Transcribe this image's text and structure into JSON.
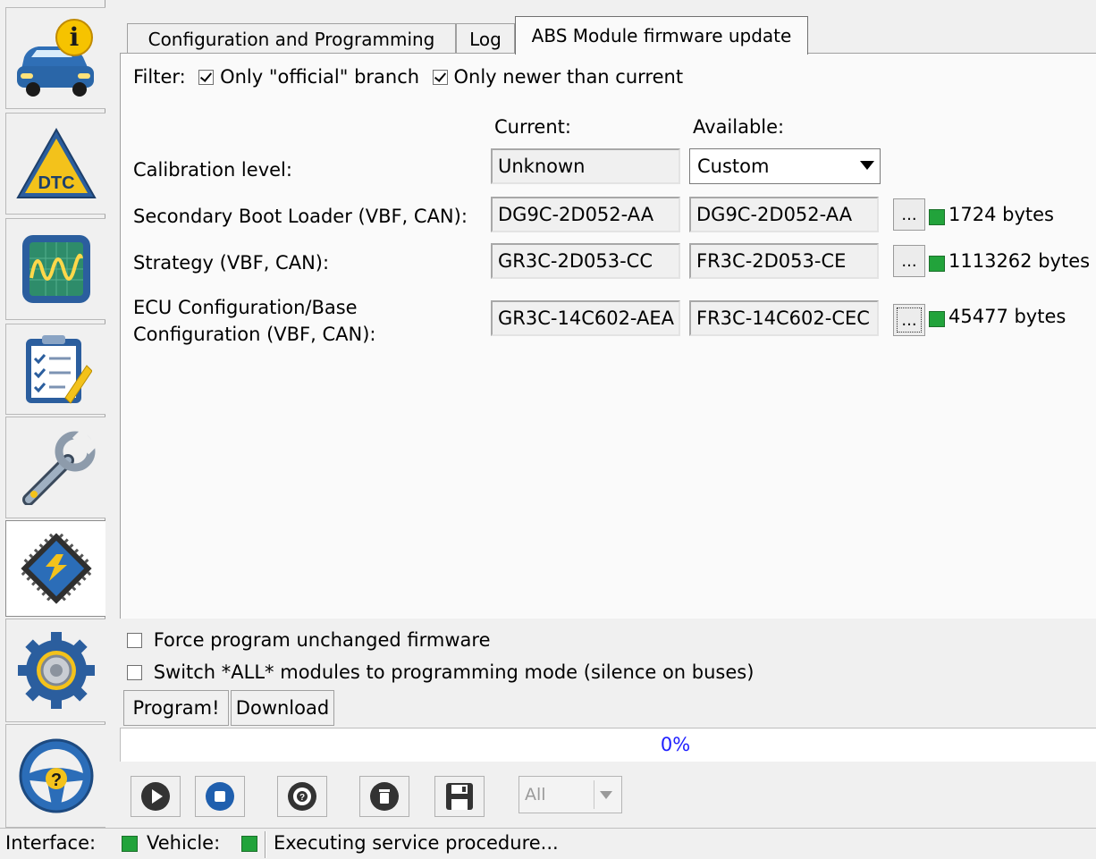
{
  "sidebar": {
    "items": [
      {
        "icon": "vehicle-info-icon"
      },
      {
        "icon": "dtc-warning-icon",
        "label": "DTC"
      },
      {
        "icon": "oscilloscope-icon"
      },
      {
        "icon": "checklist-icon"
      },
      {
        "icon": "wrench-icon"
      },
      {
        "icon": "module-programming-icon",
        "active": true
      },
      {
        "icon": "settings-gear-icon"
      },
      {
        "icon": "help-steering-wheel-icon",
        "label": "?"
      }
    ]
  },
  "tabs": [
    {
      "label": "Configuration and Programming",
      "active": false
    },
    {
      "label": "Log",
      "active": false
    },
    {
      "label": "ABS Module firmware update",
      "active": true
    }
  ],
  "filter": {
    "label": "Filter:",
    "official_label": "Only \"official\" branch",
    "official_checked": true,
    "newer_label": "Only newer than current",
    "newer_checked": true
  },
  "columns": {
    "current": "Current:",
    "available": "Available:"
  },
  "calibration": {
    "label": "Calibration level:",
    "current": "Unknown",
    "available": "Custom"
  },
  "rows": [
    {
      "label": "Secondary Boot Loader (VBF, CAN):",
      "current": "DG9C-2D052-AA",
      "available": "DG9C-2D052-AA",
      "browse": "...",
      "size": "1724 bytes"
    },
    {
      "label": "Strategy (VBF, CAN):",
      "current": "GR3C-2D053-CC",
      "available": "FR3C-2D053-CE",
      "browse": "...",
      "size": "1113262 bytes"
    },
    {
      "label_line1": "ECU Configuration/Base",
      "label_line2": "Configuration (VBF, CAN):",
      "current": "GR3C-14C602-AEA",
      "available": "FR3C-14C602-CEC",
      "browse": "...",
      "size": "45477 bytes"
    }
  ],
  "options": {
    "force_label": "Force program unchanged firmware",
    "force_checked": false,
    "switch_label": "Switch *ALL* modules to programming mode (silence on buses)",
    "switch_checked": false
  },
  "buttons": {
    "program": "Program!",
    "download": "Download"
  },
  "progress": {
    "value": 0,
    "text": "0%"
  },
  "toolbar": {
    "icons": [
      "play-icon",
      "stop-icon",
      "lifebuoy-icon",
      "trash-icon",
      "save-icon"
    ],
    "filter_value": "All"
  },
  "status": {
    "interface_label": "Interface:",
    "vehicle_label": "Vehicle:",
    "message": "Executing service procedure...",
    "ok_color": "#22a33b"
  }
}
